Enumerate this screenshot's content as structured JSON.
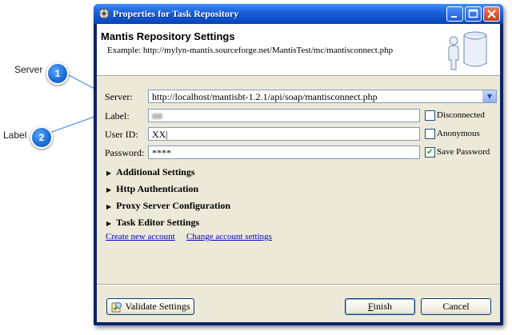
{
  "callouts": [
    {
      "label": "Server",
      "number": "1"
    },
    {
      "label": "Label",
      "number": "2"
    }
  ],
  "window": {
    "title": "Properties for Task Repository"
  },
  "header": {
    "title": "Mantis Repository Settings",
    "description": "Example: http://mylyn-mantis.sourceforge.net/MantisTest/mc/mantisconnect.php"
  },
  "form": {
    "server_label": "Server:",
    "server_value": "http://localhost/mantisbt-1.2.1/api/soap/mantisconnect.php",
    "label_label": "Label:",
    "user_label": "User ID:",
    "user_value": "XX|",
    "password_label": "Password:",
    "password_value": "****",
    "disconnected_label": "Disconnected",
    "disconnected_checked": false,
    "anonymous_label": "Anonymous",
    "anonymous_checked": false,
    "save_password_label": "Save Password",
    "save_password_checked": true
  },
  "sections": [
    "Additional Settings",
    "Http Authentication",
    "Proxy Server Configuration",
    "Task Editor Settings"
  ],
  "links": {
    "create": "Create new account",
    "change": "Change account settings"
  },
  "buttons": {
    "validate": "Validate Settings",
    "finish_f": "F",
    "finish_rest": "inish",
    "cancel": "Cancel"
  }
}
